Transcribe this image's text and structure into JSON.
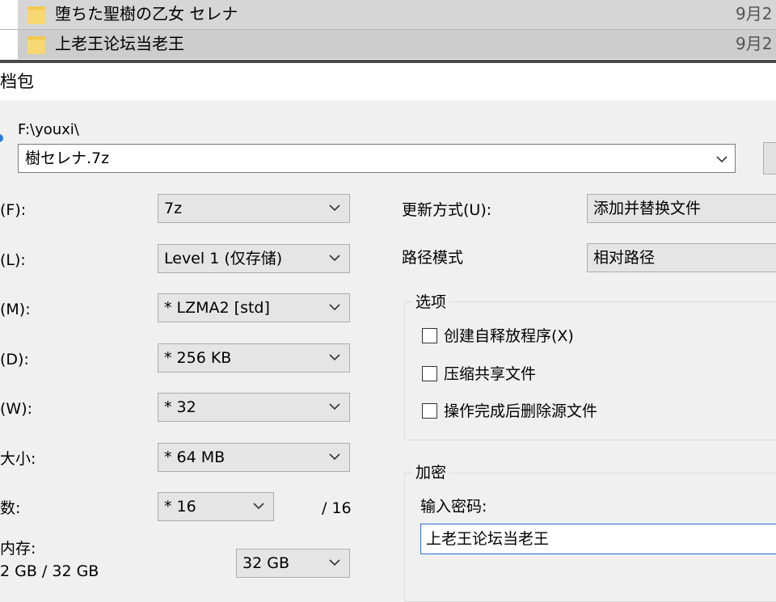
{
  "explorer": {
    "files": [
      {
        "name": "堕ちた聖樹の乙女 セレナ",
        "date": "9月2"
      },
      {
        "name": "上老王论坛当老王",
        "date": "9月2"
      }
    ]
  },
  "dialog": {
    "title": "档包",
    "path": "F:\\youxi\\",
    "archive_name": "樹セレナ.7z",
    "left": {
      "format": {
        "label": "(F):",
        "value": "7z"
      },
      "level": {
        "label": "(L):",
        "value": "Level 1 (仅存储)"
      },
      "method": {
        "label": "(M):",
        "value": "*  LZMA2 [std]"
      },
      "dictionary": {
        "label": "(D):",
        "value": "*  256 KB"
      },
      "word": {
        "label": "(W):",
        "value": "*  32"
      },
      "solid": {
        "label": "大小:",
        "value": "*  64 MB"
      },
      "threads": {
        "label": "数:",
        "value": "*  16",
        "max": "/ 16"
      },
      "memory": {
        "label": "内存:",
        "usage": "2 GB / 32 GB",
        "value": "32 GB"
      }
    },
    "right": {
      "update_mode": {
        "label": "更新方式(U):",
        "value": "添加并替换文件"
      },
      "path_mode": {
        "label": "路径模式",
        "value": "相对路径"
      },
      "options": {
        "title": "选项",
        "items": [
          "创建自释放程序(X)",
          "压缩共享文件",
          "操作完成后删除源文件"
        ]
      },
      "encryption": {
        "title": "加密",
        "password_label": "输入密码:",
        "password_value": "上老王论坛当老王"
      }
    }
  }
}
